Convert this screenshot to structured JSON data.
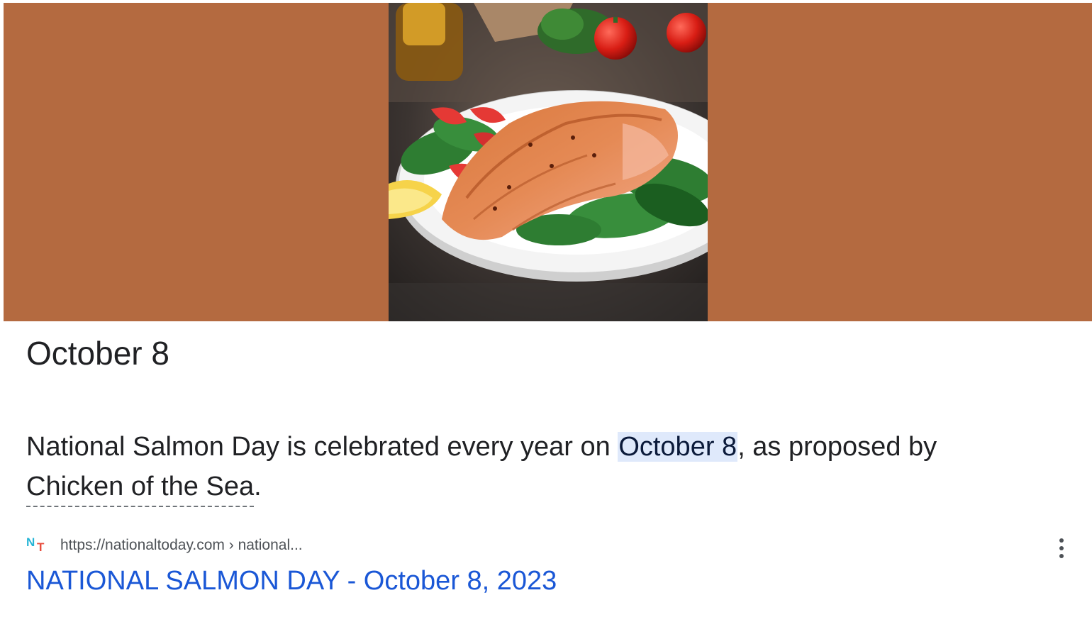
{
  "hero": {
    "background_color": "#b46a40",
    "image_subject": "grilled salmon fillet with spinach, cherry tomatoes and lemon on a white plate"
  },
  "answer": {
    "title": "October 8",
    "snippet_before": "National Salmon Day is celebrated every year on ",
    "snippet_highlight": "October 8",
    "snippet_middle": ", as proposed by ",
    "snippet_link": "Chicken of the Sea",
    "snippet_after": "."
  },
  "source": {
    "favicon_letters": [
      "N",
      "T"
    ],
    "url": "https://nationaltoday.com › national...",
    "result_title": "NATIONAL SALMON DAY - October 8, 2023"
  },
  "icons": {
    "more_options": "more-vert-icon"
  },
  "colors": {
    "link_blue": "#1a57d6",
    "highlight_bg": "#dfe9fb",
    "favicon_n": "#26b5d6",
    "favicon_t": "#e84c3d"
  }
}
